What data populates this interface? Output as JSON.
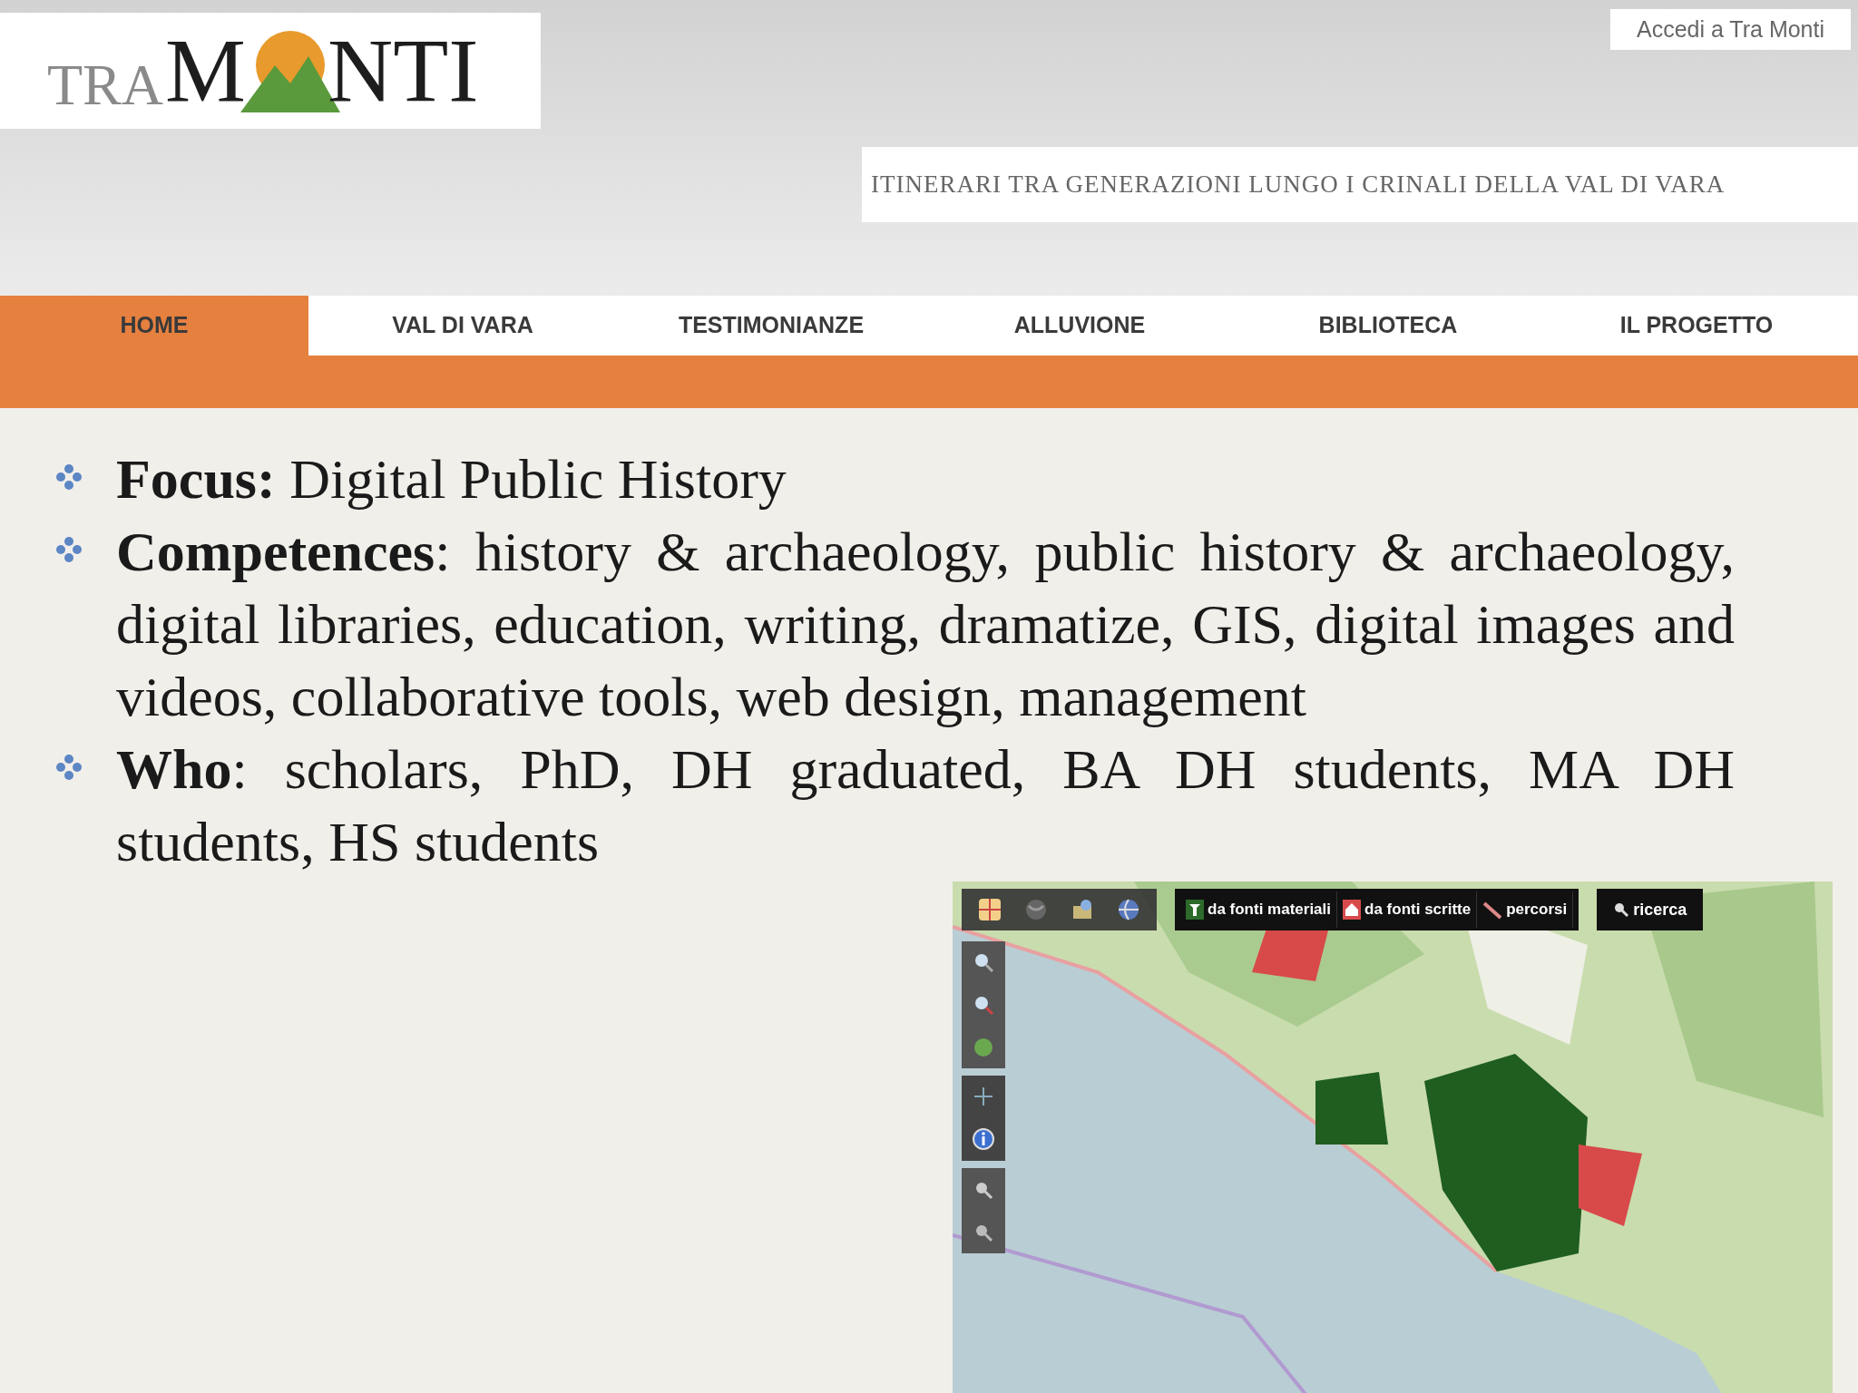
{
  "site": {
    "logo": {
      "prefix": "TRA",
      "first": "M",
      "rest": "NTI"
    },
    "login_link": "Accedi a Tra Monti",
    "tagline": "ITINERARI TRA GENERAZIONI LUNGO I CRINALI DELLA VAL DI VARA",
    "nav": [
      {
        "label": "HOME",
        "selected": true
      },
      {
        "label": "VAL DI VARA",
        "selected": false
      },
      {
        "label": "TESTIMONIANZE",
        "selected": false
      },
      {
        "label": "ALLUVIONE",
        "selected": false
      },
      {
        "label": "BIBLIOTECA",
        "selected": false
      },
      {
        "label": "IL PROGETTO",
        "selected": false
      }
    ]
  },
  "bullets": [
    "**Focus:** Digital Public History",
    "**Competences**: history & archaeology, public history & archaeology, digital libraries, education, writing, dramatize, GIS, digital images and videos, collaborative tools, web design, management",
    "**Who**: scholars, PhD, DH graduated, BA DH students, MA DH students, HS students"
  ],
  "map": {
    "kind": "picture",
    "layers": [
      {
        "label": "da fonti materiali",
        "kind": "material"
      },
      {
        "label": "da fonti scritte",
        "kind": "written"
      },
      {
        "label": "percorsi",
        "kind": "path"
      }
    ],
    "search_button": "ricerca"
  }
}
